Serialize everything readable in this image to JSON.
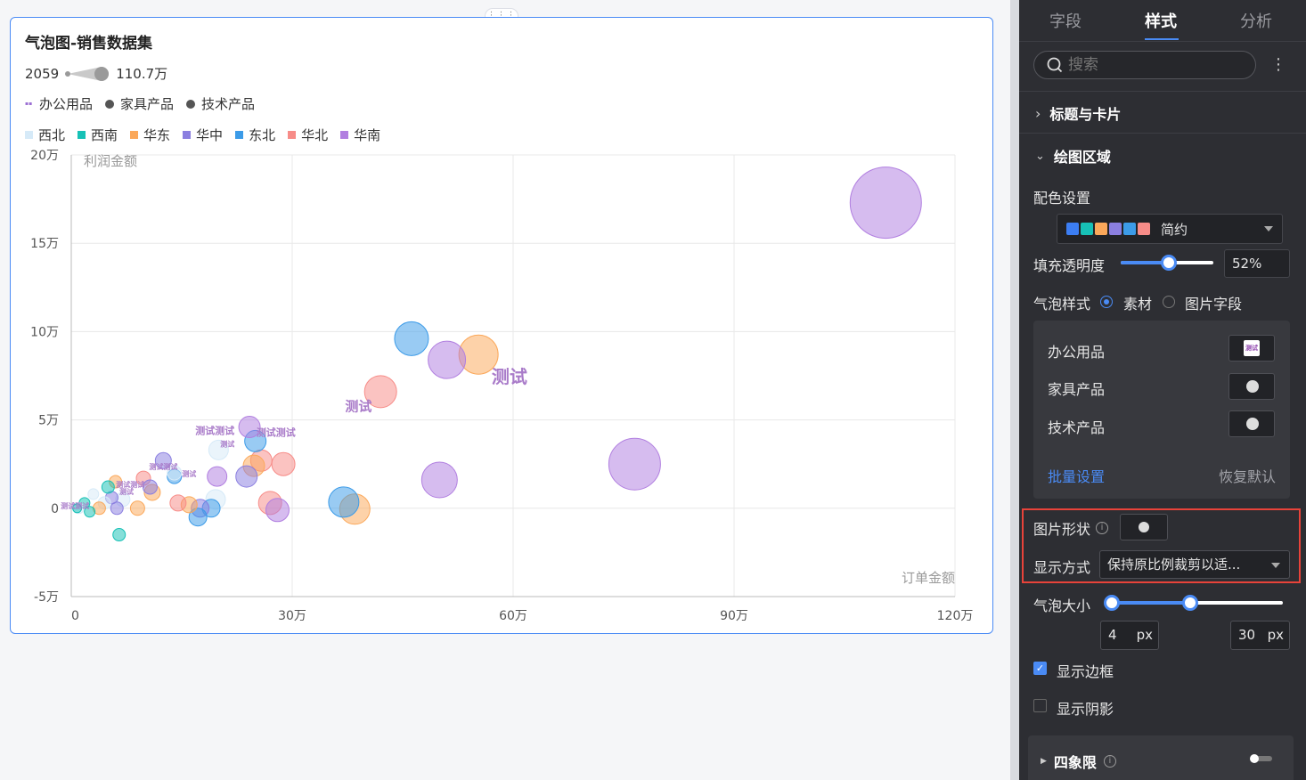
{
  "chart_data": {
    "type": "scatter",
    "title": "气泡图-销售数据集",
    "xlabel": "订单金额",
    "ylabel": "利润金额",
    "xlim": [
      0,
      1200000
    ],
    "ylim": [
      -50000,
      200000
    ],
    "x_ticks": [
      "0",
      "30万",
      "60万",
      "90万",
      "120万"
    ],
    "y_ticks": [
      "20万",
      "15万",
      "10万",
      "5万",
      "0",
      "-5万"
    ],
    "size_legend": {
      "min": "2059",
      "max": "110.7万"
    },
    "shape_legend": [
      "办公用品",
      "家具产品",
      "技术产品"
    ],
    "regions": [
      {
        "name": "西北",
        "color": "#d6eaf8"
      },
      {
        "name": "西南",
        "color": "#17c1b6"
      },
      {
        "name": "华东",
        "color": "#fba85a"
      },
      {
        "name": "华中",
        "color": "#8b7fe0"
      },
      {
        "name": "东北",
        "color": "#3c9be8"
      },
      {
        "name": "华北",
        "color": "#f78c88"
      },
      {
        "name": "华南",
        "color": "#b17fe0"
      }
    ],
    "points": [
      {
        "x": 1106000,
        "y": 173000,
        "size": 40,
        "region": "华南"
      },
      {
        "x": 765000,
        "y": 25000,
        "size": 29,
        "region": "华南"
      },
      {
        "x": 553000,
        "y": 87000,
        "size": 22,
        "region": "华东"
      },
      {
        "x": 510000,
        "y": 84000,
        "size": 21,
        "region": "华南"
      },
      {
        "x": 462000,
        "y": 96000,
        "size": 19,
        "region": "东北"
      },
      {
        "x": 420000,
        "y": 66000,
        "size": 18,
        "region": "华北"
      },
      {
        "x": 500000,
        "y": 16000,
        "size": 20,
        "region": "华南"
      },
      {
        "x": 385000,
        "y": -500,
        "size": 17,
        "region": "华东"
      },
      {
        "x": 370000,
        "y": 3500,
        "size": 17,
        "region": "东北"
      },
      {
        "x": 288000,
        "y": 25000,
        "size": 13,
        "region": "华北"
      },
      {
        "x": 270000,
        "y": 3000,
        "size": 13,
        "region": "华北"
      },
      {
        "x": 280000,
        "y": -1000,
        "size": 13,
        "region": "华南"
      },
      {
        "x": 258000,
        "y": 27000,
        "size": 12,
        "region": "华北"
      },
      {
        "x": 248000,
        "y": 24000,
        "size": 12,
        "region": "华东"
      },
      {
        "x": 250000,
        "y": 38000,
        "size": 12,
        "region": "东北"
      },
      {
        "x": 242000,
        "y": 46000,
        "size": 12,
        "region": "华南"
      },
      {
        "x": 238000,
        "y": 18000,
        "size": 12,
        "region": "华中"
      },
      {
        "x": 198000,
        "y": 18000,
        "size": 11,
        "region": "华南"
      },
      {
        "x": 200000,
        "y": 33000,
        "size": 11,
        "region": "西北"
      },
      {
        "x": 196000,
        "y": 5000,
        "size": 11,
        "region": "西北"
      },
      {
        "x": 190000,
        "y": 0,
        "size": 10,
        "region": "东北"
      },
      {
        "x": 175000,
        "y": 0,
        "size": 10,
        "region": "华中"
      },
      {
        "x": 172000,
        "y": -5000,
        "size": 10,
        "region": "东北"
      },
      {
        "x": 160000,
        "y": 2000,
        "size": 9,
        "region": "华东"
      },
      {
        "x": 145000,
        "y": 3000,
        "size": 9,
        "region": "华北"
      },
      {
        "x": 110000,
        "y": 9000,
        "size": 9,
        "region": "华东"
      },
      {
        "x": 98000,
        "y": 17000,
        "size": 8,
        "region": "华北"
      },
      {
        "x": 140000,
        "y": 18000,
        "size": 8,
        "region": "东北"
      },
      {
        "x": 125000,
        "y": 27000,
        "size": 9,
        "region": "华中"
      },
      {
        "x": 140000,
        "y": 20000,
        "size": 8,
        "region": "西北"
      },
      {
        "x": 107000,
        "y": 12000,
        "size": 8,
        "region": "华中"
      },
      {
        "x": 90000,
        "y": 0,
        "size": 8,
        "region": "华东"
      },
      {
        "x": 70000,
        "y": 5000,
        "size": 8,
        "region": "西北"
      },
      {
        "x": 60000,
        "y": 15000,
        "size": 7,
        "region": "华东"
      },
      {
        "x": 55000,
        "y": 6000,
        "size": 7,
        "region": "华中"
      },
      {
        "x": 50000,
        "y": 12000,
        "size": 7,
        "region": "西南"
      },
      {
        "x": 45000,
        "y": 3000,
        "size": 7,
        "region": "西北"
      },
      {
        "x": 38000,
        "y": 0,
        "size": 7,
        "region": "华东"
      },
      {
        "x": 30000,
        "y": 8000,
        "size": 6,
        "region": "西北"
      },
      {
        "x": 25000,
        "y": -2000,
        "size": 6,
        "region": "西南"
      },
      {
        "x": 18000,
        "y": 3000,
        "size": 6,
        "region": "西南"
      },
      {
        "x": 10000,
        "y": 0,
        "size": 6,
        "region": "西北"
      },
      {
        "x": 8000,
        "y": 0,
        "size": 5,
        "region": "西南"
      },
      {
        "x": 65000,
        "y": -15000,
        "size": 7,
        "region": "西南"
      },
      {
        "x": 62000,
        "y": 0,
        "size": 7,
        "region": "华中"
      }
    ],
    "image_marks": [
      {
        "x": 595000,
        "y": 71000,
        "text": "测试",
        "size": "large"
      },
      {
        "x": 390000,
        "y": 55000,
        "text": "测试",
        "size": "medium"
      },
      {
        "x": 278000,
        "y": 41000,
        "text": "测试测试",
        "size": "small"
      },
      {
        "x": 195000,
        "y": 42000,
        "text": "测试测试",
        "size": "small"
      },
      {
        "x": 212000,
        "y": 35000,
        "text": "测试",
        "size": "tiny"
      },
      {
        "x": 125000,
        "y": 22000,
        "text": "测试测试",
        "size": "tiny"
      },
      {
        "x": 160000,
        "y": 18000,
        "text": "测试",
        "size": "tiny"
      },
      {
        "x": 80000,
        "y": 12000,
        "text": "测试测试",
        "size": "tiny"
      },
      {
        "x": 75000,
        "y": 8000,
        "text": "测试",
        "size": "tiny"
      },
      {
        "x": 5000,
        "y": 0,
        "text": "测试测试",
        "size": "tiny"
      }
    ]
  },
  "panel": {
    "tabs": [
      "字段",
      "样式",
      "分析"
    ],
    "search_placeholder": "搜索",
    "section_title_card": "标题与卡片",
    "section_plot_area": "绘图区域",
    "color_setting_label": "配色设置",
    "color_scheme_name": "简约",
    "color_scheme_swatches": [
      "#3c7ef3",
      "#17c1b6",
      "#fba85a",
      "#8b7fe0",
      "#3c9be8",
      "#f78c88"
    ],
    "fill_opacity_label": "填充透明度",
    "fill_opacity_value": "52%",
    "fill_opacity_fraction": 0.52,
    "bubble_style_label": "气泡样式",
    "bubble_style_options": [
      "素材",
      "图片字段"
    ],
    "materials": [
      "办公用品",
      "家具产品",
      "技术产品"
    ],
    "material_thumb_text": "测试",
    "batch_setting": "批量设置",
    "restore_default": "恢复默认",
    "image_shape_label": "图片形状",
    "display_mode_label": "显示方式",
    "display_mode_value": "保持原比例裁剪以适...",
    "bubble_size_label": "气泡大小",
    "bubble_size_min": "4",
    "bubble_size_max": "30",
    "bubble_size_unit": "px",
    "bubble_size_min_fraction": 0.0,
    "bubble_size_max_fraction": 0.46,
    "show_border_label": "显示边框",
    "show_shadow_label": "显示阴影",
    "quadrant_label": "四象限"
  }
}
